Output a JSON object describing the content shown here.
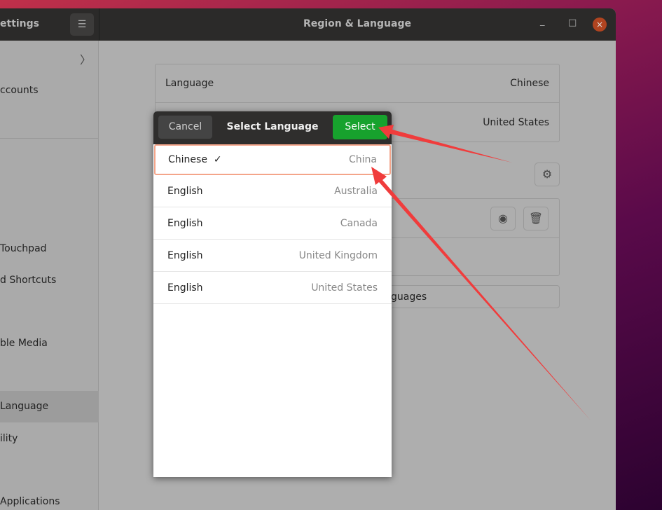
{
  "window": {
    "app_title": "ettings",
    "title": "Region & Language",
    "minimize": "_",
    "maximize": "□",
    "close": "×",
    "menu": "☰"
  },
  "sidebar": {
    "items": [
      {
        "label": "ccounts"
      },
      {
        "label": " Touchpad"
      },
      {
        "label": "d Shortcuts"
      },
      {
        "label": "ble Media"
      },
      {
        "label": " Language",
        "selected": true
      },
      {
        "label": "ility"
      },
      {
        "label": " Applications"
      }
    ]
  },
  "main": {
    "rows": [
      {
        "label": "Language",
        "value": "Chinese"
      },
      {
        "label": "",
        "value": "United States"
      }
    ],
    "manage_button": "guages"
  },
  "dialog": {
    "cancel": "Cancel",
    "title": "Select Language",
    "select": "Select",
    "select_color": "#17a22d",
    "items": [
      {
        "language": "Chinese",
        "region": "China",
        "checked": true
      },
      {
        "language": "English",
        "region": "Australia"
      },
      {
        "language": "English",
        "region": "Canada"
      },
      {
        "language": "English",
        "region": "United Kingdom"
      },
      {
        "language": "English",
        "region": "United States"
      }
    ]
  },
  "annotations": {
    "arrow_color": "#f03c3c"
  }
}
